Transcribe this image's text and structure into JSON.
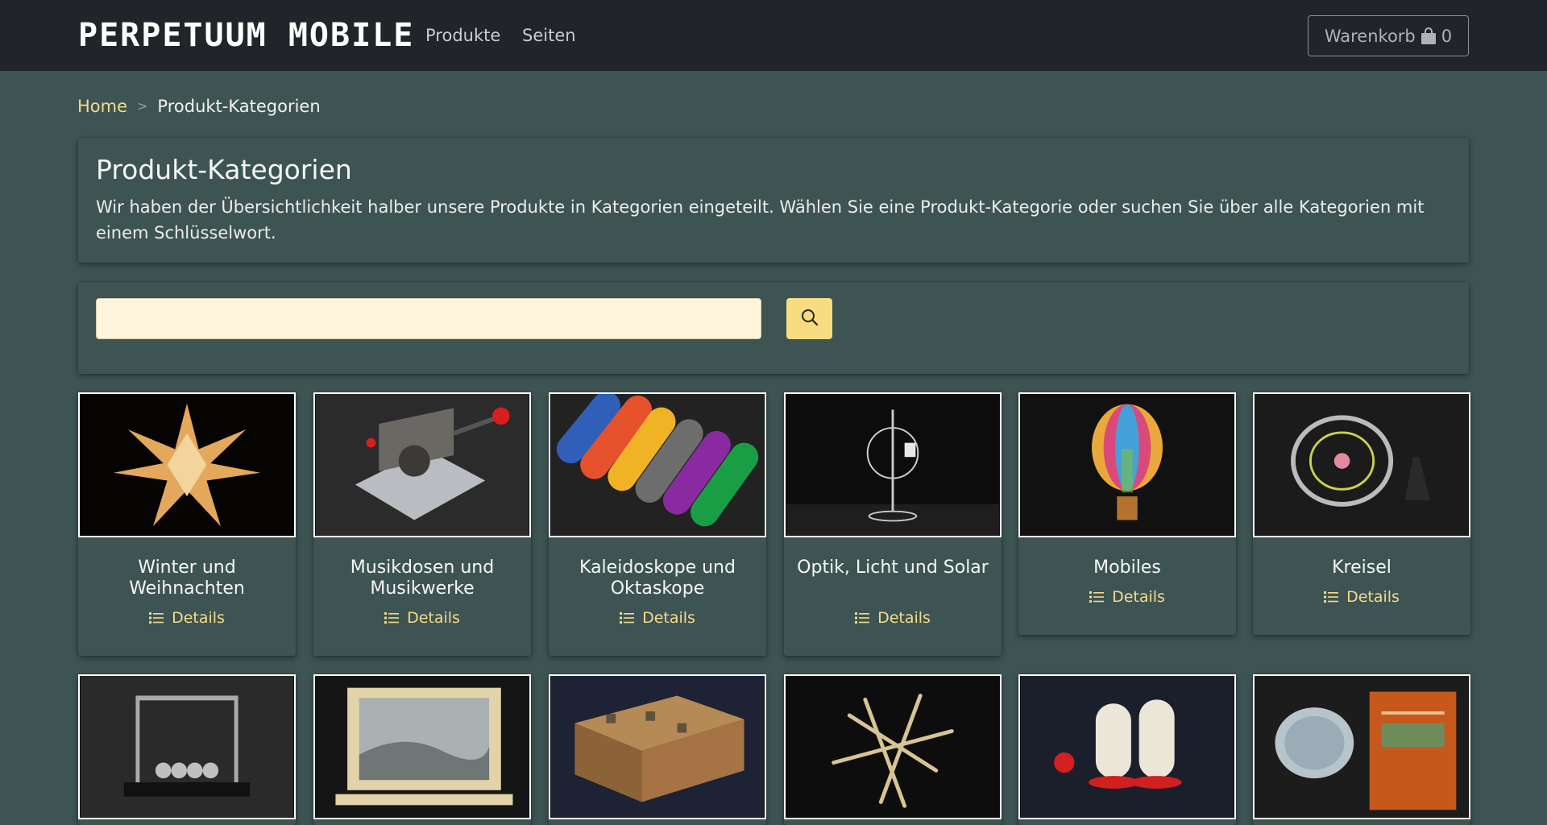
{
  "brand": {
    "name": "PERPETUUM MOBILE"
  },
  "nav": {
    "items": [
      {
        "label": "Produkte"
      },
      {
        "label": "Seiten"
      }
    ]
  },
  "cart": {
    "label": "Warenkorb",
    "count": "0",
    "icon": "shopping-bag-icon"
  },
  "breadcrumb": {
    "home": "Home",
    "separator": ">",
    "current": "Produkt-Kategorien"
  },
  "intro": {
    "title": "Produkt-Kategorien",
    "text": "Wir haben der Übersichtlichkeit halber unsere Produkte in Kategorien eingeteilt. Wählen Sie eine Produkt-Kategorie oder suchen Sie über alle Kategorien mit einem Schlüsselwort."
  },
  "search": {
    "value": "",
    "placeholder": "",
    "icon": "search-icon"
  },
  "details_label": "Details",
  "categories": [
    {
      "title": "Winter und Weihnachten",
      "image": "star-lamp"
    },
    {
      "title": "Musikdosen und Musikwerke",
      "image": "music-box"
    },
    {
      "title": "Kaleidoskope und Oktaskope",
      "image": "kaleidoscope-tubes"
    },
    {
      "title": "Optik, Licht und Solar",
      "image": "radiometer"
    },
    {
      "title": "Mobiles",
      "image": "hot-air-balloon"
    },
    {
      "title": "Kreisel",
      "image": "gyroscope"
    },
    {
      "title": "",
      "image": "newtons-cradle"
    },
    {
      "title": "",
      "image": "sand-picture"
    },
    {
      "title": "",
      "image": "puzzle-box"
    },
    {
      "title": "",
      "image": "tensegrity"
    },
    {
      "title": "",
      "image": "wooden-figures"
    },
    {
      "title": "",
      "image": "hologram-sheet"
    }
  ],
  "colors": {
    "background": "#3d5452",
    "navbar": "#212529",
    "accent": "#f4da8b",
    "search_field": "#fff4dc",
    "search_button": "#f8dc82"
  }
}
